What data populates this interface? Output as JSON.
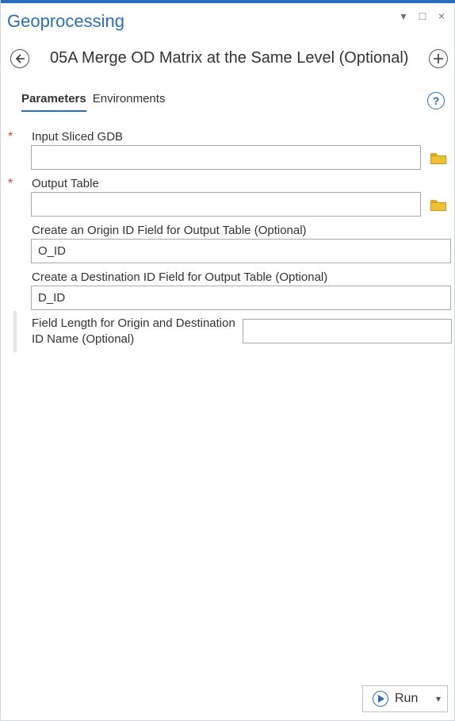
{
  "window": {
    "title": "Geoprocessing",
    "controls": {
      "dropdown": "▾",
      "restore": "□",
      "close": "×"
    }
  },
  "tool": {
    "title": "05A Merge OD Matrix at the Same Level (Optional)",
    "back_icon": "back-arrow-icon",
    "add_icon": "plus-icon"
  },
  "tabs": [
    {
      "label": "Parameters",
      "active": true
    },
    {
      "label": "Environments",
      "active": false
    }
  ],
  "help": {
    "icon": "help-icon",
    "glyph": "?"
  },
  "params": {
    "input_sliced_gdb": {
      "label": "Input Sliced GDB",
      "value": "",
      "required_mark": "*"
    },
    "output_table": {
      "label": "Output Table",
      "value": "",
      "required_mark": "*"
    },
    "origin_id_field": {
      "label": "Create an Origin ID Field for Output Table (Optional)",
      "value": "O_ID"
    },
    "destination_id_field": {
      "label": "Create a Destination ID Field for Output Table (Optional)",
      "value": "D_ID"
    },
    "field_length": {
      "label": "Field Length for Origin and Destination ID Name (Optional)",
      "value": ""
    }
  },
  "run": {
    "label": "Run",
    "caret": "▾"
  },
  "colors": {
    "accent": "#2a6ebb",
    "required": "#c94a2e",
    "folder": "#f0c133"
  }
}
